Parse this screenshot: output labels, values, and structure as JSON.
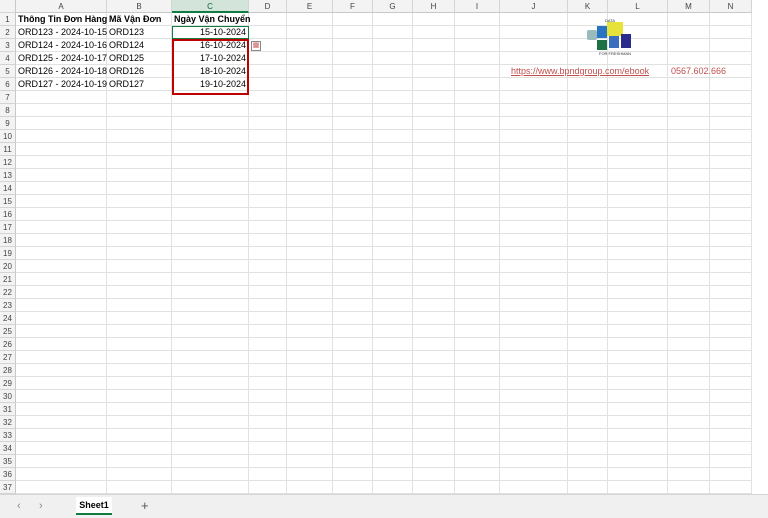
{
  "columns": [
    "A",
    "B",
    "C",
    "D",
    "E",
    "F",
    "G",
    "H",
    "I",
    "J",
    "K",
    "L",
    "M",
    "N"
  ],
  "selected_column": "C",
  "row_count": 37,
  "rows": [
    [
      "Thông Tin Đơn Hàng",
      "Mã Vận Đơn",
      "Ngày Vận Chuyển"
    ],
    [
      "ORD123 - 2024-10-15",
      "ORD123",
      "15-10-2024"
    ],
    [
      "ORD124 - 2024-10-16",
      "ORD124",
      "16-10-2024"
    ],
    [
      "ORD125 - 2024-10-17",
      "ORD125",
      "17-10-2024"
    ],
    [
      "ORD126 - 2024-10-18",
      "ORD126",
      "18-10-2024"
    ],
    [
      "ORD127 - 2024-10-19",
      "ORD127",
      "19-10-2024"
    ]
  ],
  "link": "https://www.bpndgroup.com/ebook",
  "phone": "0567.602.666",
  "logo_text": "DATA FOR FRESHMAN",
  "sheet_tabs": [
    {
      "label": "Sheet1",
      "active": true
    }
  ],
  "add_sheet": "+",
  "nav_prev": "‹",
  "nav_next": "›",
  "colors": {
    "accent": "#107c41",
    "highlight": "#c00000",
    "link": "#c0504d"
  }
}
